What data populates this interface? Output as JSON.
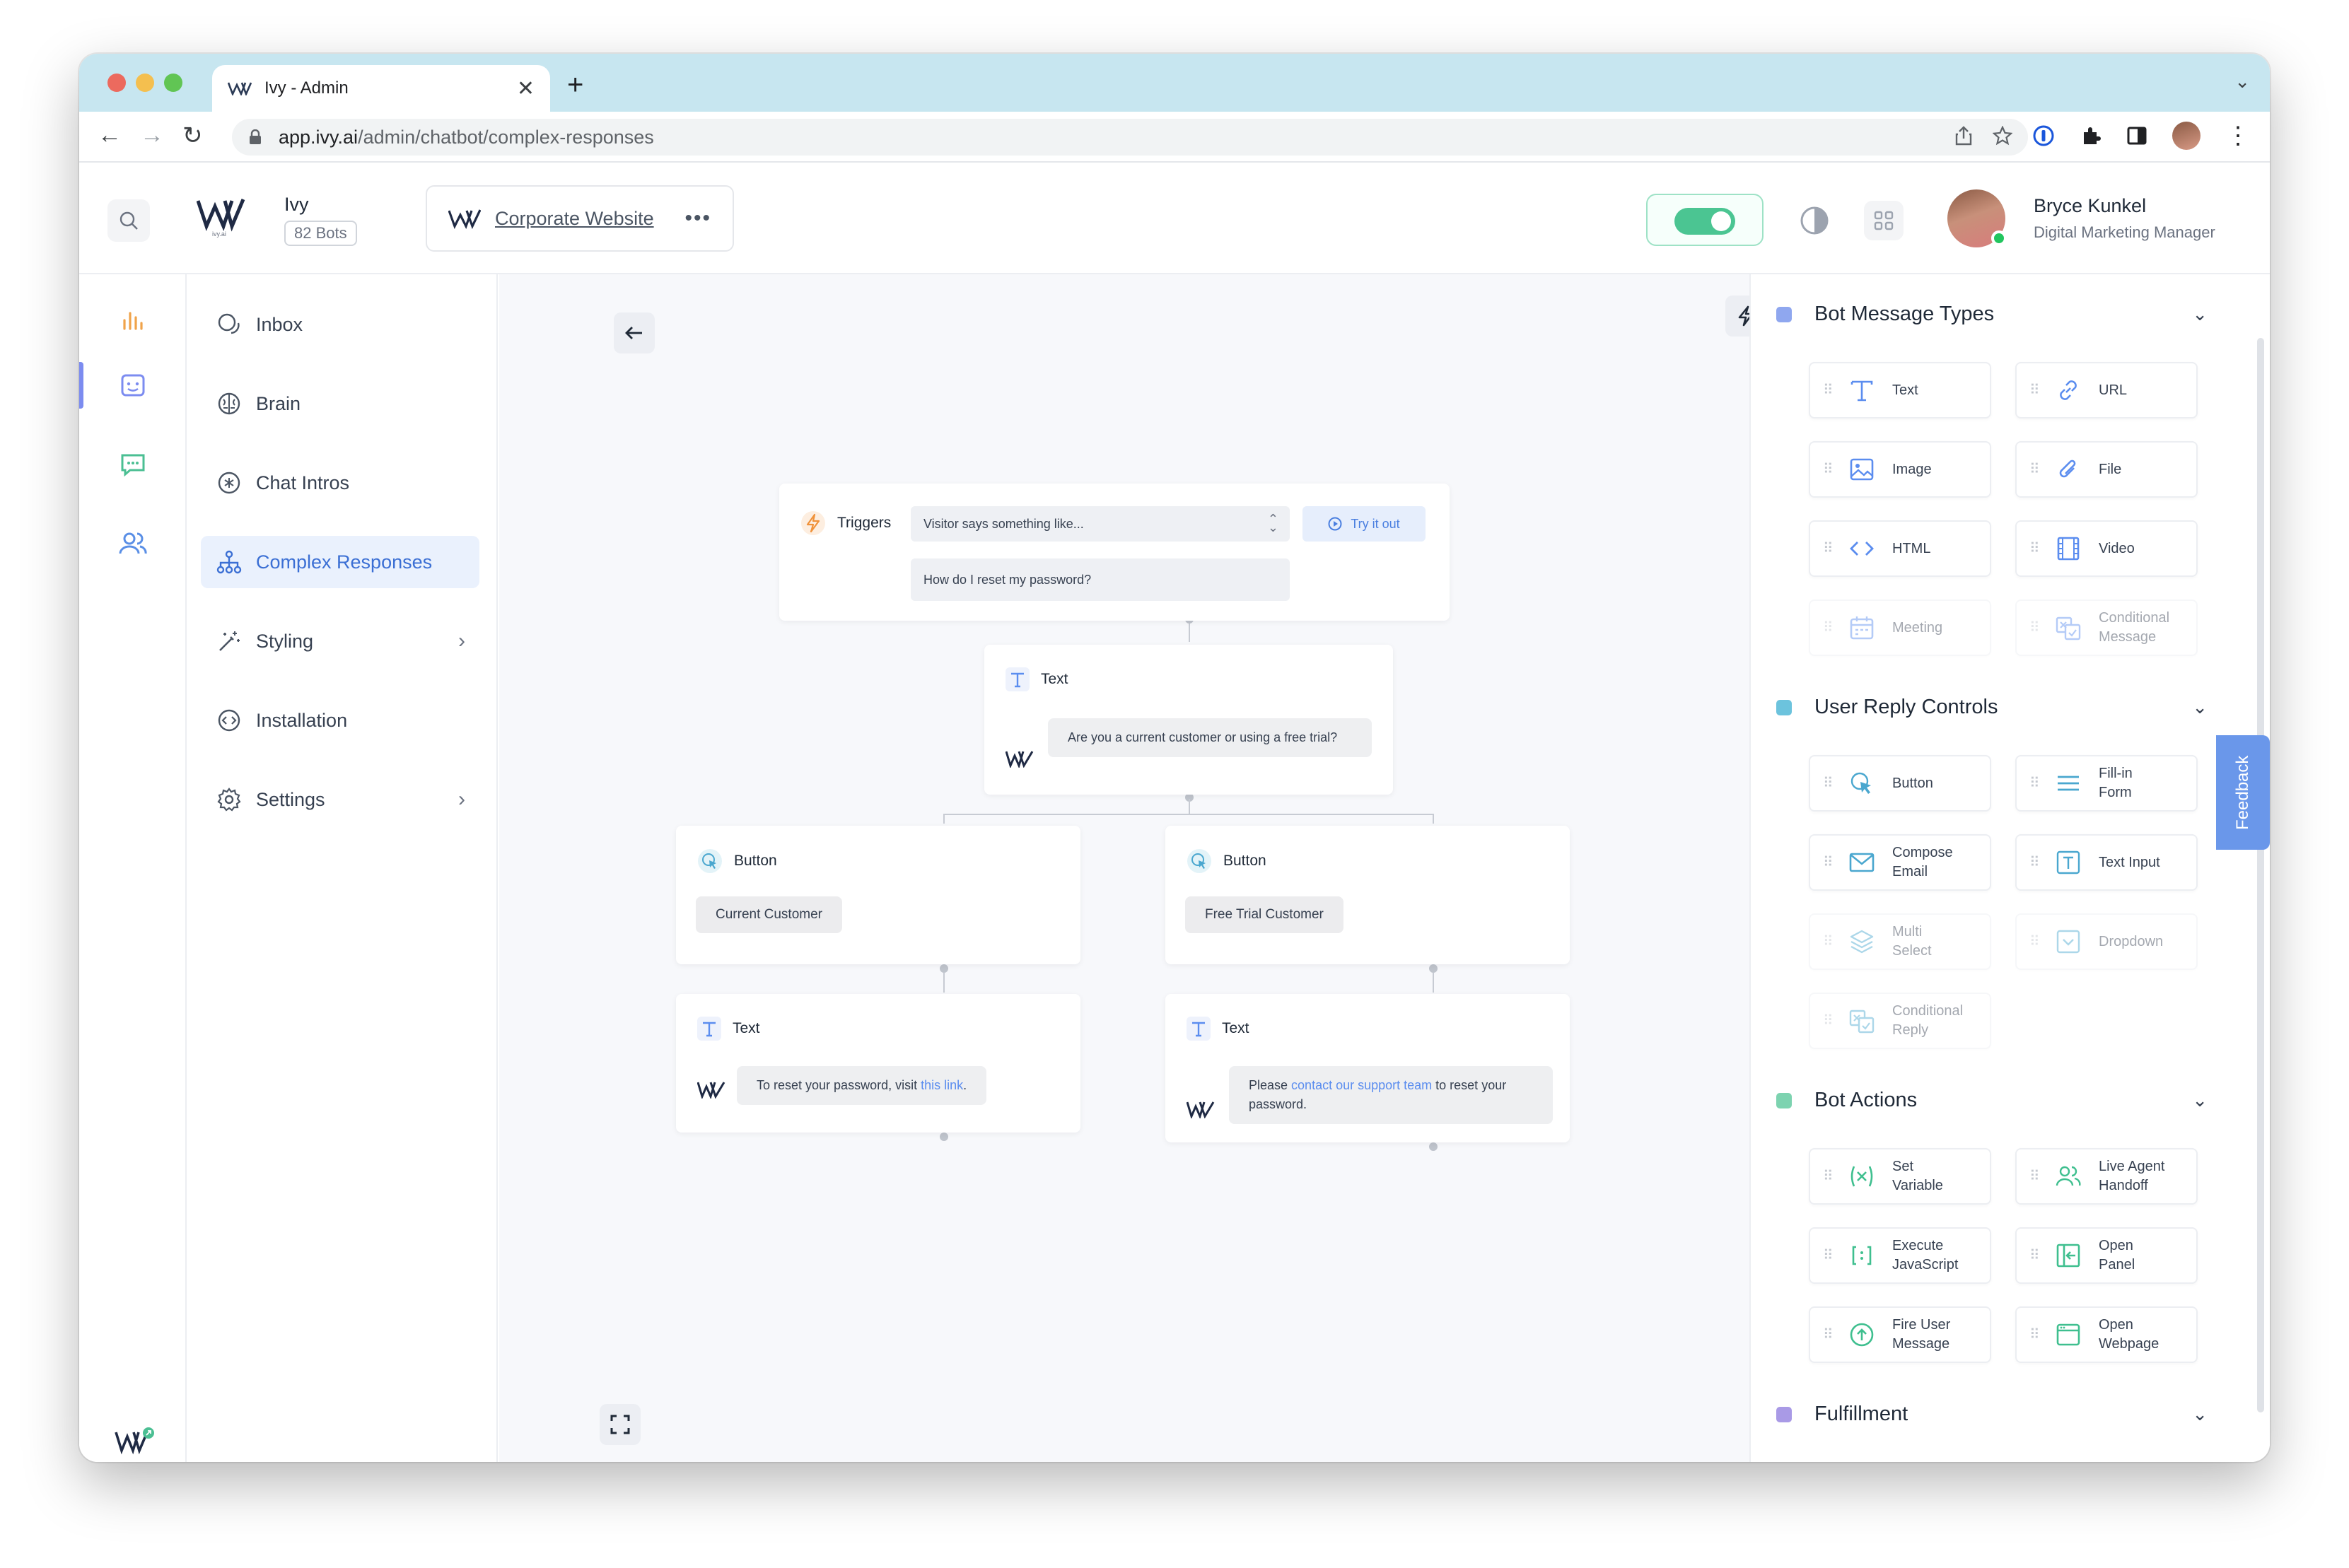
{
  "browser": {
    "tab_title": "Ivy - Admin",
    "url_host": "app.ivy.ai",
    "url_path": "/admin/chatbot/complex-responses"
  },
  "header": {
    "brand_name": "Ivy",
    "bot_count": "82 Bots",
    "site_name": "Corporate Website",
    "site_menu": "•••",
    "user_name": "Bryce Kunkel",
    "user_role": "Digital Marketing Manager",
    "toggle_on": true
  },
  "nav": {
    "items": [
      {
        "label": "Inbox"
      },
      {
        "label": "Brain"
      },
      {
        "label": "Chat Intros"
      },
      {
        "label": "Complex Responses"
      },
      {
        "label": "Styling"
      },
      {
        "label": "Installation"
      },
      {
        "label": "Settings"
      }
    ]
  },
  "flow": {
    "triggers": {
      "label": "Triggers",
      "select_value": "Visitor says something like...",
      "try_label": "Try it out",
      "phrase": "How do I reset my password?"
    },
    "text1": {
      "label": "Text",
      "message": "Are you a current customer or using a free trial?"
    },
    "button_left": {
      "label": "Button",
      "chip": "Current Customer"
    },
    "button_right": {
      "label": "Button",
      "chip": "Free Trial Customer"
    },
    "text_left": {
      "label": "Text",
      "pre": "To reset your password, visit ",
      "link": "this link",
      "post": "."
    },
    "text_right": {
      "label": "Text",
      "pre": "Please ",
      "link": "contact our support team",
      "post": " to reset your password."
    }
  },
  "panel": {
    "sections": [
      {
        "title": "Bot Message Types",
        "color": "#8fa7ef"
      },
      {
        "title": "User Reply Controls",
        "color": "#6cc3dd"
      },
      {
        "title": "Bot Actions",
        "color": "#7dd3b0"
      },
      {
        "title": "Fulfillment",
        "color": "#a99ae6"
      }
    ],
    "bot_message_types": [
      "Text",
      "URL",
      "Image",
      "File",
      "HTML",
      "Video",
      "Meeting",
      "Conditional\nMessage"
    ],
    "user_reply_controls": [
      "Button",
      "Fill-in\nForm",
      "Compose\nEmail",
      "Text Input",
      "Multi\nSelect",
      "Dropdown",
      "Conditional\nReply"
    ],
    "bot_actions": [
      "Set\nVariable",
      "Live Agent\nHandoff",
      "Execute\nJavaScript",
      "Open\nPanel",
      "Fire User\nMessage",
      "Open\nWebpage"
    ],
    "feedback": "Feedback"
  },
  "colors": {
    "accent": "#3b6fd4",
    "message_type_icon": "#5b8def",
    "action_icon": "#3fbf8f",
    "toggle": "#4bc592"
  }
}
